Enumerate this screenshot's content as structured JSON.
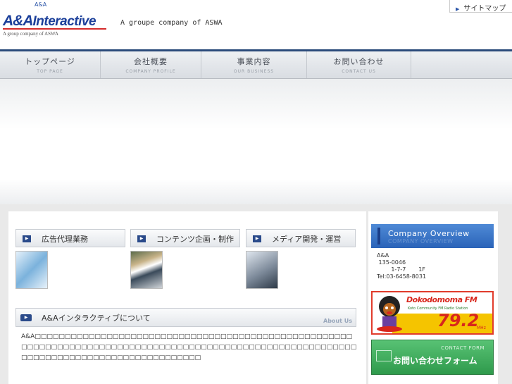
{
  "header": {
    "top_small": "A&A",
    "logo_aa": "A&A",
    "logo_interactive": "Interactive",
    "logo_sub": "A group company of ASWA",
    "tagline": "A groupe company of ASWA",
    "sitemap": "サイトマップ"
  },
  "nav": [
    {
      "jp": "トップページ",
      "en": "TOP PAGE"
    },
    {
      "jp": "会社概要",
      "en": "COMPANY PROFILE"
    },
    {
      "jp": "事業内容",
      "en": "OUR BUSINESS"
    },
    {
      "jp": "お問い合わせ",
      "en": "CONTACT US"
    }
  ],
  "services": [
    {
      "label": "広告代理業務"
    },
    {
      "label": "コンテンツ企画・制作"
    },
    {
      "label": "メディア開発・運営"
    }
  ],
  "about": {
    "title": "A&Aインタラクティブについて",
    "title_en": "About Us",
    "text": "A&A□□□□□□□□□□□□□□□□□□□□□□□□□□□□□□□□□□□□□□□□□□□□□□□□□□□□□□□□□□□□□□□□□□□□□□□□□□□□□□□□□□□□□□□□□□□□□□□□□□□□□□□□□□□□□□□□□□□□□□□□□□□□□□□□□□□□□□□□□□□"
  },
  "sidebar": {
    "company_title": "Company Overview",
    "company_title_ghost": "COMPANY OVERVIEW",
    "company_lines": [
      "A&A",
      " 135-0046",
      "        1-7-7       1F",
      "Tel:03-6458-8031"
    ],
    "fm_title": "Dokodomoma FM",
    "fm_sub": "Koto Community FM Radio Station",
    "fm_number": "79.2",
    "fm_mhz": "MHz",
    "contact_en": "CONTACT FORM",
    "contact_jp": "お問い合わせフォーム"
  },
  "colors": {
    "brand_blue": "#1b3f9a",
    "nav_border": "#2a4a7a",
    "contact_green": "#2f9a4c",
    "fm_red": "#d8261c"
  }
}
